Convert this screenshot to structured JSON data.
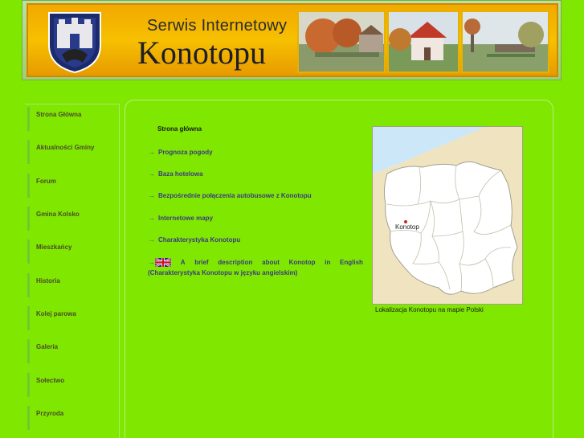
{
  "banner": {
    "title_small": "Serwis Internetowy",
    "title_big": "Konotopu"
  },
  "sidebar": {
    "items": [
      {
        "label": "Strona Główna"
      },
      {
        "label": "Aktualności Gminy"
      },
      {
        "label": "Forum"
      },
      {
        "label": "Gmina Kolsko"
      },
      {
        "label": "Mieszkańcy"
      },
      {
        "label": "Historia"
      },
      {
        "label": "Kolej parowa"
      },
      {
        "label": "Galeria"
      },
      {
        "label": "Sołectwo"
      },
      {
        "label": "Przyroda"
      }
    ]
  },
  "main": {
    "title": "Strona główna",
    "links": [
      {
        "label": "Prognoza pogody"
      },
      {
        "label": "Baza hotelowa"
      },
      {
        "label": "Bezpośrednie połączenia autobusowe z Konotopu"
      },
      {
        "label": "Internetowe mapy"
      },
      {
        "label": "Charakterystyka Konotopu"
      }
    ],
    "english_line1_words": [
      "A",
      "brief",
      "description",
      "about",
      "Konotop",
      "in",
      "English"
    ],
    "english_line2": "(Charakterystyka Konotopu w języku angielskim)"
  },
  "map": {
    "marker_label": "Konotop",
    "caption": "Lokalizacja Konotopu na mapie Polski"
  },
  "colors": {
    "background": "#80e800",
    "banner": "#f6c000",
    "link": "#3a3a80"
  }
}
